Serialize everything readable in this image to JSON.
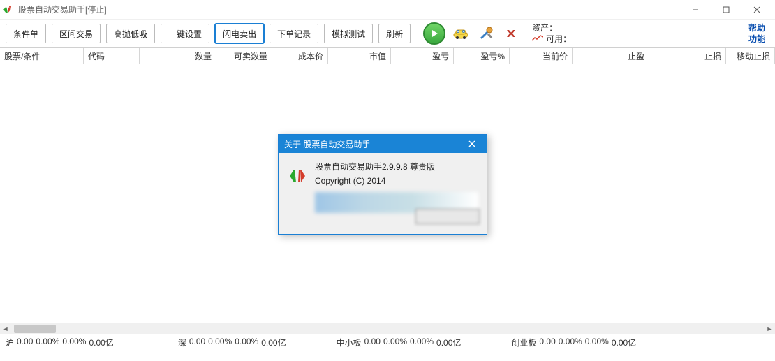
{
  "window": {
    "title": "股票自动交易助手[停止]"
  },
  "toolbar": {
    "buttons": {
      "b0": "条件单",
      "b1": "区间交易",
      "b2": "高抛低吸",
      "b3": "一键设置",
      "b4": "闪电卖出",
      "b5": "下单记录",
      "b6": "模拟测试",
      "b7": "刷新"
    },
    "asset_label": "资产：",
    "available_label": "可用：",
    "help_label": "帮助",
    "function_label": "功能"
  },
  "columns": {
    "c0": "股票/条件",
    "c1": "代码",
    "c2": "数量",
    "c3": "可卖数量",
    "c4": "成本价",
    "c5": "市值",
    "c6": "盈亏",
    "c7": "盈亏%",
    "c8": "当前价",
    "c9": "止盈",
    "c10": "止损",
    "c11": "移动止损"
  },
  "status": {
    "seg1_label": "沪",
    "seg1_v1": "0.00",
    "seg1_v2": "0.00%",
    "seg1_v3": "0.00%",
    "seg1_v4": "0.00亿",
    "seg2_label": "深",
    "seg2_v1": "0.00",
    "seg2_v2": "0.00%",
    "seg2_v3": "0.00%",
    "seg2_v4": "0.00亿",
    "seg3_label": "中小板",
    "seg3_v1": "0.00",
    "seg3_v2": "0.00%",
    "seg3_v3": "0.00%",
    "seg3_v4": "0.00亿",
    "seg4_label": "创业板",
    "seg4_v1": "0.00",
    "seg4_v2": "0.00%",
    "seg4_v3": "0.00%",
    "seg4_v4": "0.00亿"
  },
  "dialog": {
    "title": "关于 股票自动交易助手",
    "line1": "股票自动交易助手2.9.9.8 尊贵版",
    "line2": "Copyright (C) 2014"
  }
}
